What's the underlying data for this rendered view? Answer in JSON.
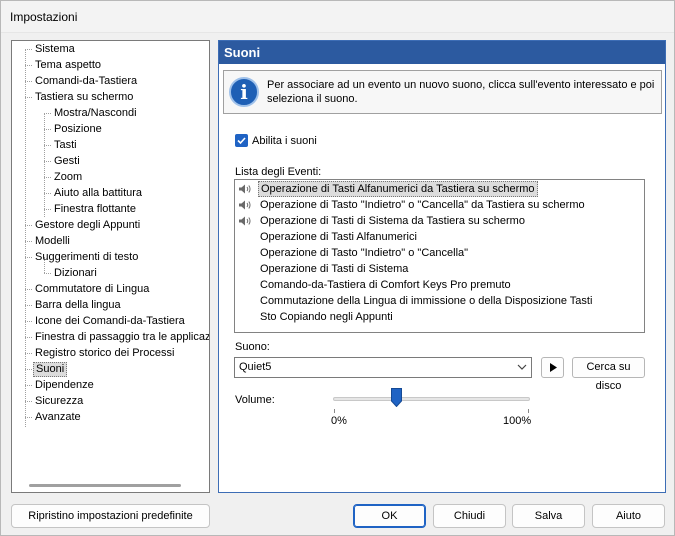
{
  "window": {
    "title": "Impostazioni"
  },
  "tree": {
    "items": [
      {
        "label": "Sistema",
        "level": 0
      },
      {
        "label": "Tema aspetto",
        "level": 0
      },
      {
        "label": "Comandi-da-Tastiera",
        "level": 0
      },
      {
        "label": "Tastiera su schermo",
        "level": 0
      },
      {
        "label": "Mostra/Nascondi",
        "level": 1
      },
      {
        "label": "Posizione",
        "level": 1
      },
      {
        "label": "Tasti",
        "level": 1
      },
      {
        "label": "Gesti",
        "level": 1
      },
      {
        "label": "Zoom",
        "level": 1
      },
      {
        "label": "Aiuto alla battitura",
        "level": 1
      },
      {
        "label": "Finestra flottante",
        "level": 1
      },
      {
        "label": "Gestore degli Appunti",
        "level": 0
      },
      {
        "label": "Modelli",
        "level": 0
      },
      {
        "label": "Suggerimenti di testo",
        "level": 0
      },
      {
        "label": "Dizionari",
        "level": 1
      },
      {
        "label": "Commutatore di Lingua",
        "level": 0
      },
      {
        "label": "Barra della lingua",
        "level": 0
      },
      {
        "label": "Icone dei Comandi-da-Tastiera",
        "level": 0
      },
      {
        "label": "Finestra di passaggio tra le applicazioni",
        "level": 0
      },
      {
        "label": "Registro storico dei Processi",
        "level": 0
      },
      {
        "label": "Suoni",
        "level": 0,
        "selected": true
      },
      {
        "label": "Dipendenze",
        "level": 0
      },
      {
        "label": "Sicurezza",
        "level": 0
      },
      {
        "label": "Avanzate",
        "level": 0
      }
    ]
  },
  "panel": {
    "title": "Suoni",
    "info_icon": "info-icon",
    "info_text": "Per associare ad un evento un nuovo suono, clicca sull'evento interessato e poi seleziona il suono.",
    "enable_sounds": {
      "label": "Abilita i suoni",
      "checked": true
    },
    "events_label": "Lista degli Eventi:",
    "events": [
      {
        "label": "Operazione di Tasti Alfanumerici da Tastiera su schermo",
        "has_sound": true,
        "selected": true
      },
      {
        "label": "Operazione di Tasto \"Indietro\" o \"Cancella\" da Tastiera su schermo",
        "has_sound": true
      },
      {
        "label": "Operazione di Tasti di Sistema da Tastiera su schermo",
        "has_sound": true
      },
      {
        "label": "Operazione di Tasti Alfanumerici",
        "has_sound": false
      },
      {
        "label": "Operazione di Tasto \"Indietro\" o \"Cancella\"",
        "has_sound": false
      },
      {
        "label": "Operazione di Tasti di Sistema",
        "has_sound": false
      },
      {
        "label": "Comando-da-Tastiera di Comfort Keys Pro premuto",
        "has_sound": false
      },
      {
        "label": "Commutazione della Lingua di immissione o della Disposizione Tasti",
        "has_sound": false
      },
      {
        "label": "Sto Copiando negli Appunti",
        "has_sound": false
      }
    ],
    "sound_label": "Suono:",
    "sound_value": "Quiet5",
    "play_icon": "play-icon",
    "browse_label": "Cerca su disco",
    "volume_label": "Volume:",
    "volume_value": 0.32,
    "volume_min_label": "0%",
    "volume_max_label": "100%"
  },
  "buttons": {
    "restore": "Ripristino impostazioni predefinite",
    "ok": "OK",
    "close": "Chiudi",
    "save": "Salva",
    "help": "Aiuto"
  },
  "colors": {
    "header": "#2c5aa0",
    "accent": "#1f63c4"
  }
}
